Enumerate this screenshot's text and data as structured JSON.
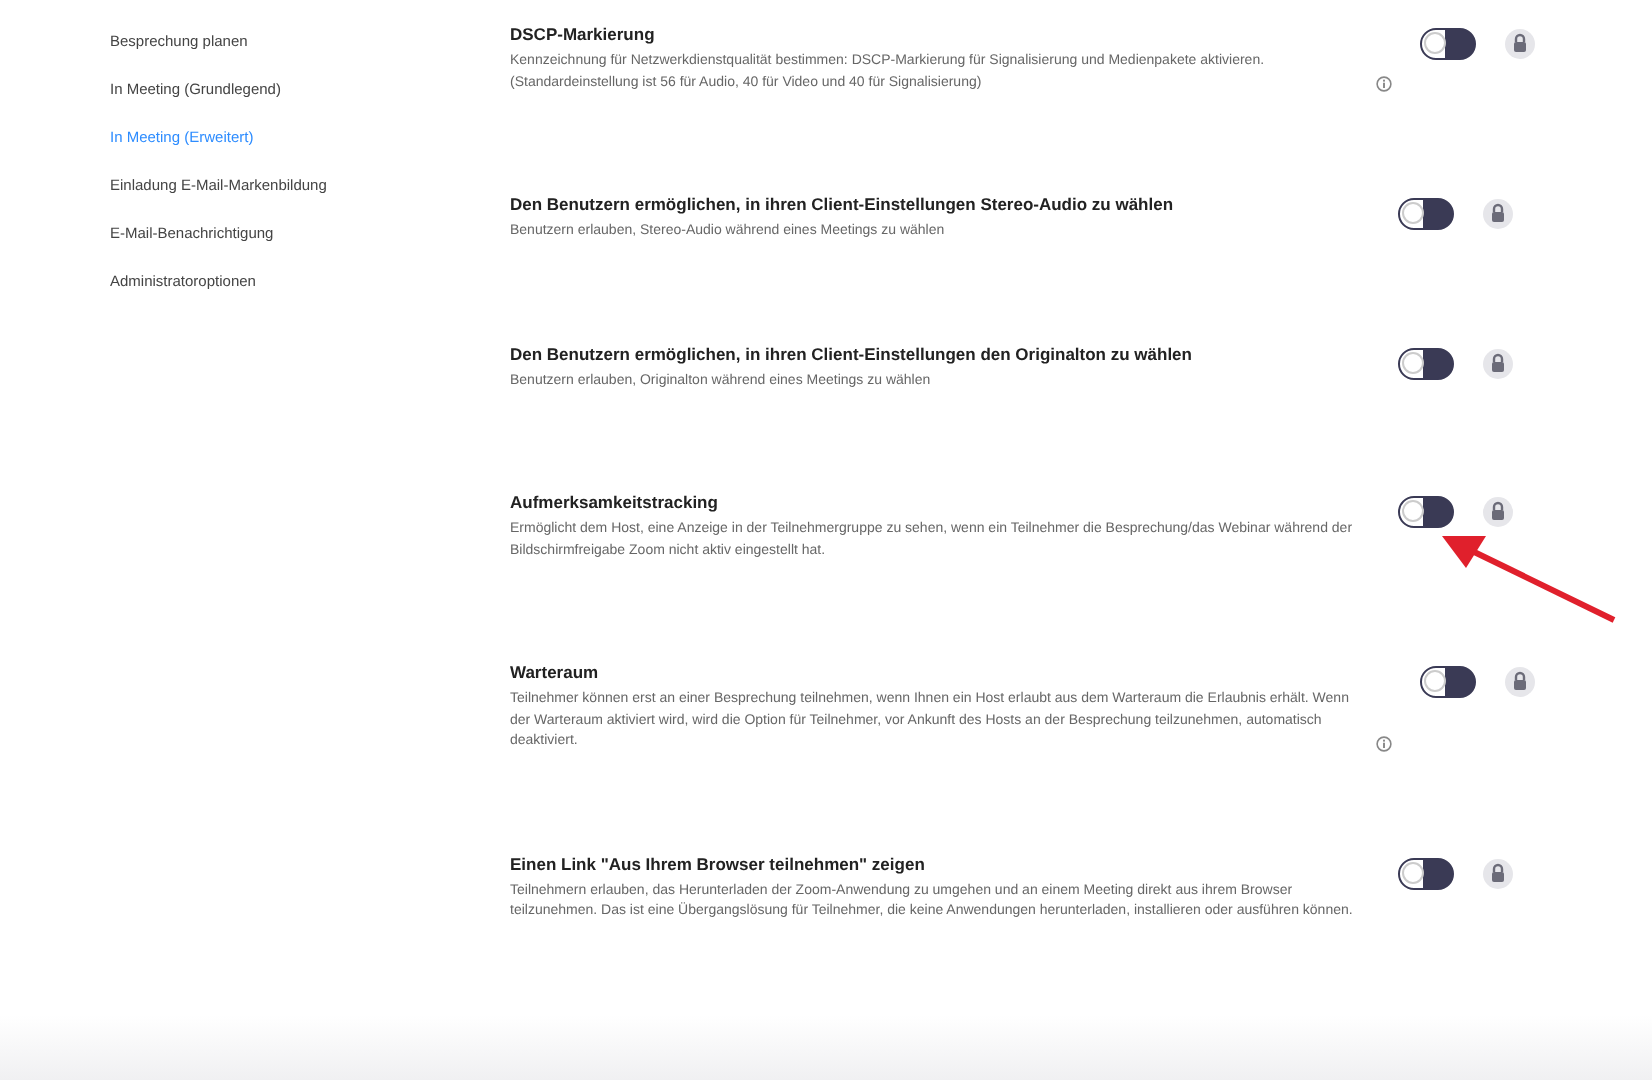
{
  "sidebar": {
    "items": [
      {
        "label": "Besprechung planen",
        "selected": false
      },
      {
        "label": "In Meeting (Grundlegend)",
        "selected": false
      },
      {
        "label": "In Meeting (Erweitert)",
        "selected": true
      },
      {
        "label": "Einladung E-Mail-Markenbildung",
        "selected": false
      },
      {
        "label": "E-Mail-Benachrichtigung",
        "selected": false
      },
      {
        "label": "Administratoroptionen",
        "selected": false
      }
    ]
  },
  "settings": [
    {
      "title": "DSCP-Markierung",
      "description": "Kennzeichnung für Netzwerkdienstqualität bestimmen: DSCP-Markierung für Signalisierung und Medienpakete aktivieren. (Standardeinstellung ist 56 für Audio, 40 für Video und 40 für Signalisierung)",
      "info": true,
      "on": false,
      "locked": true,
      "highlighted": false
    },
    {
      "title": "Den Benutzern ermöglichen, in ihren Client-Einstellungen Stereo-Audio zu wählen",
      "description": "Benutzern erlauben, Stereo-Audio während eines Meetings zu wählen",
      "info": false,
      "on": false,
      "locked": true,
      "highlighted": false
    },
    {
      "title": "Den Benutzern ermöglichen, in ihren Client-Einstellungen den Originalton zu wählen",
      "description": "Benutzern erlauben, Originalton während eines Meetings zu wählen",
      "info": false,
      "on": false,
      "locked": true,
      "highlighted": false
    },
    {
      "title": "Aufmerksamkeitstracking",
      "description": "Ermöglicht dem Host, eine Anzeige in der Teilnehmergruppe zu sehen, wenn ein Teilnehmer die Besprechung/das Webinar während der Bildschirmfreigabe Zoom nicht aktiv eingestellt hat.",
      "info": false,
      "on": false,
      "locked": true,
      "highlighted": true
    },
    {
      "title": "Warteraum",
      "description": "Teilnehmer können erst an einer Besprechung teilnehmen, wenn Ihnen ein Host erlaubt aus dem Warteraum die Erlaubnis erhält. Wenn der Warteraum aktiviert wird, wird die Option für Teilnehmer, vor Ankunft des Hosts an der Besprechung teilzunehmen, automatisch deaktiviert.",
      "info": true,
      "on": false,
      "locked": true,
      "highlighted": false
    },
    {
      "title": "Einen Link \"Aus Ihrem Browser teilnehmen\" zeigen",
      "description": "Teilnehmern erlauben, das Herunterladen der Zoom-Anwendung zu umgehen und an einem Meeting direkt aus ihrem Browser teilzunehmen. Das ist eine Übergangslösung für Teilnehmer, die keine Anwendungen herunterladen, installieren oder ausführen können.",
      "info": false,
      "on": false,
      "locked": true,
      "highlighted": false
    }
  ]
}
